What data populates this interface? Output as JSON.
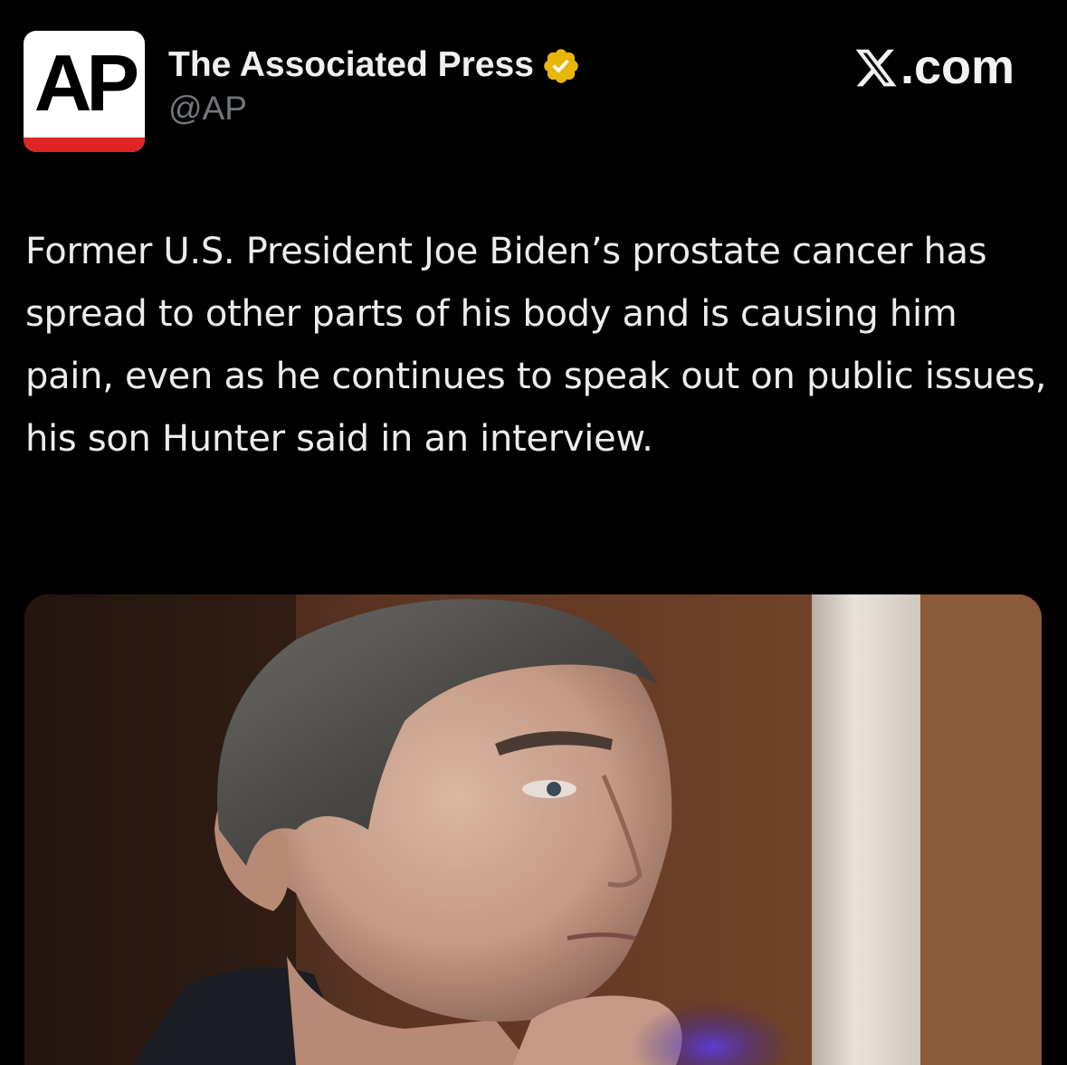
{
  "post": {
    "author": {
      "display_name": "The Associated Press",
      "handle": "@AP",
      "avatar_text": "AP",
      "verified_icon": "verified-gold-badge-icon"
    },
    "source_label": ".com",
    "source_icon": "x-logo-icon",
    "text": "Former U.S. President Joe Biden’s prostate cancer has spread to other parts of his body and is causing him pain, even as he continues to speak out on public issues, his son Hunter said in an interview.",
    "media": {
      "type": "photo"
    }
  },
  "colors": {
    "background": "#000000",
    "text_primary": "#ececec",
    "text_secondary": "#71767b",
    "verified_gold": "#e8b50a",
    "ap_red": "#e02424"
  }
}
